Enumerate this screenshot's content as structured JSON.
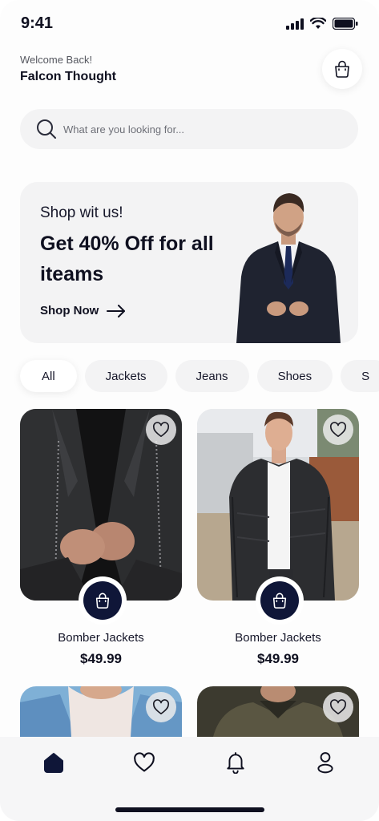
{
  "status_bar": {
    "time": "9:41"
  },
  "header": {
    "welcome": "Welcome Back!",
    "username": "Falcon Thought"
  },
  "search": {
    "placeholder": "What are you looking for..."
  },
  "banner": {
    "subtitle": "Shop wit us!",
    "headline": "Get 40% Off for all iteams",
    "cta": "Shop Now"
  },
  "categories": [
    {
      "label": "All",
      "active": true
    },
    {
      "label": "Jackets"
    },
    {
      "label": "Jeans"
    },
    {
      "label": "Shoes"
    },
    {
      "label": "S"
    }
  ],
  "products": [
    {
      "name": "Bomber Jackets",
      "price": "$49.99"
    },
    {
      "name": "Bomber Jackets",
      "price": "$49.99"
    }
  ],
  "bottom_nav": [
    "home-icon",
    "heart-icon",
    "bell-icon",
    "profile-icon"
  ],
  "colors": {
    "primary": "#0f1638",
    "surface": "#f3f3f4",
    "text": "#0f1020"
  }
}
